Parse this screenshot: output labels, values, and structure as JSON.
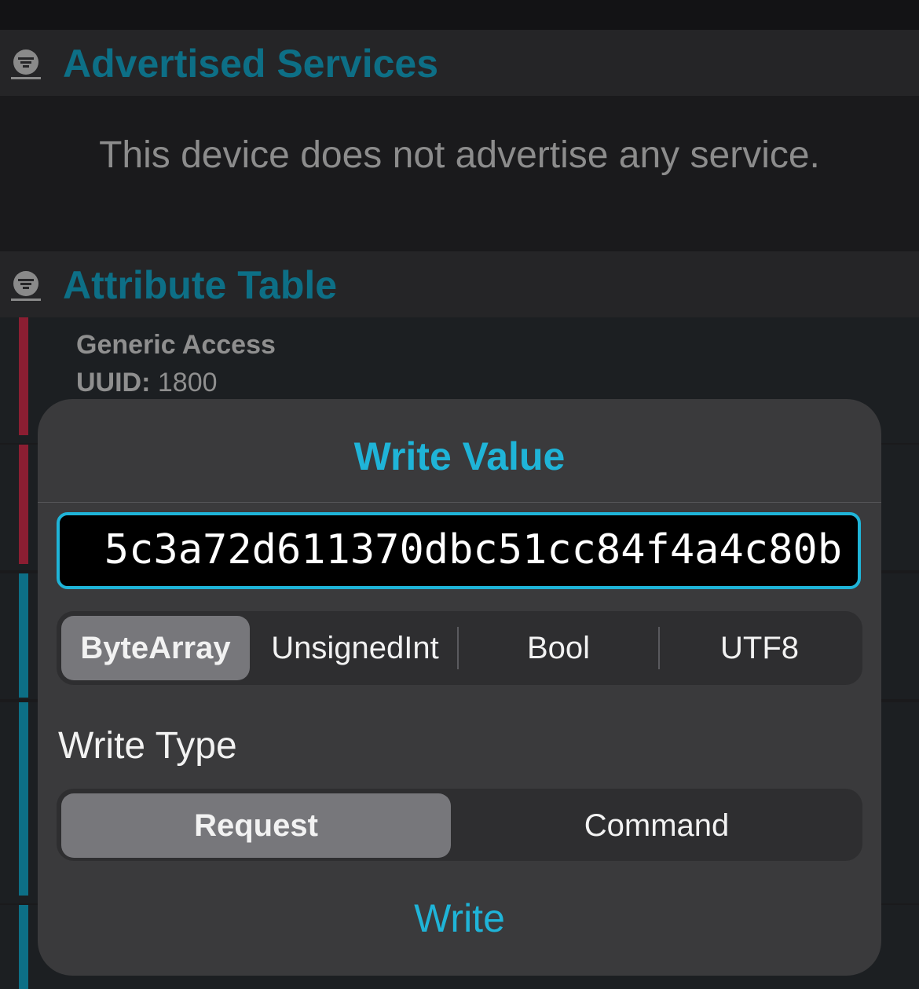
{
  "sections": {
    "advertised": {
      "title": "Advertised Services",
      "icon": "filter-icon",
      "empty_message": "This device does not advertise any service."
    },
    "attribute_table": {
      "title": "Attribute Table",
      "icon": "filter-icon",
      "items": [
        {
          "name": "Generic Access",
          "uuid_label": "UUID:",
          "uuid": "1800",
          "accent": "#8b1e32"
        }
      ]
    }
  },
  "modal": {
    "title": "Write Value",
    "value": "5c3a72d611370dbc51cc84f4a4c80b",
    "formats": {
      "options": [
        "ByteArray",
        "UnsignedInt",
        "Bool",
        "UTF8"
      ],
      "selected": "ByteArray"
    },
    "write_type": {
      "label": "Write Type",
      "options": [
        "Request",
        "Command"
      ],
      "selected": "Request"
    },
    "write_button": "Write"
  },
  "colors": {
    "accent": "#1fb4d8",
    "header_title": "#0d6f86",
    "service_bar_red": "#8b1e32",
    "service_bar_teal": "#0d6f86"
  }
}
